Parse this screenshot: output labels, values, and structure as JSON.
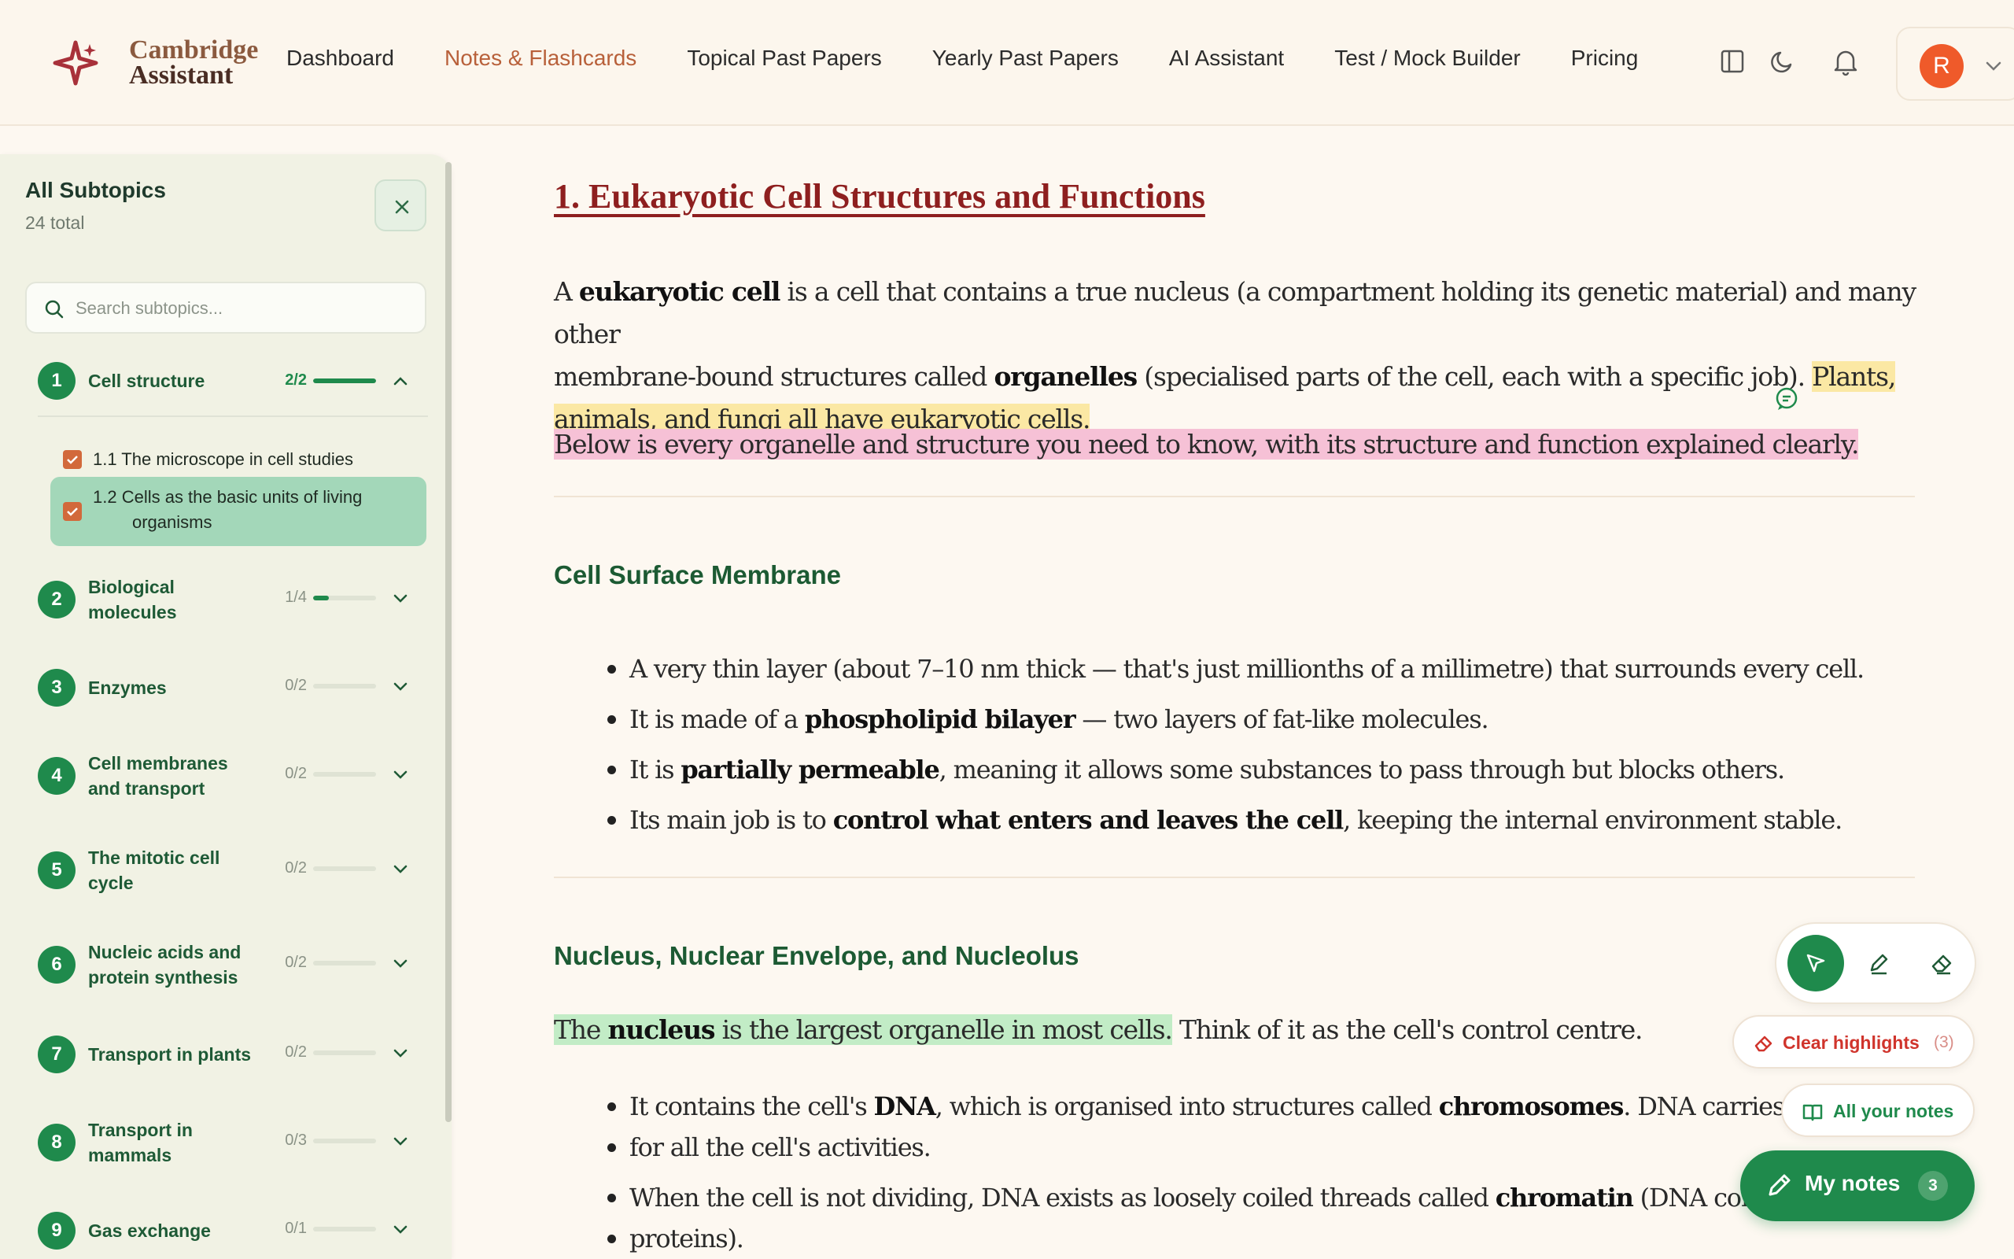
{
  "brand": {
    "line1": "Cambridge",
    "line2": "Assistant"
  },
  "nav": {
    "items": [
      {
        "label": "Dashboard",
        "active": false
      },
      {
        "label": "Notes & Flashcards",
        "active": true
      },
      {
        "label": "Topical Past Papers",
        "active": false
      },
      {
        "label": "Yearly Past Papers",
        "active": false
      },
      {
        "label": "AI Assistant",
        "active": false
      },
      {
        "label": "Test / Mock Builder",
        "active": false
      },
      {
        "label": "Pricing",
        "active": false
      }
    ]
  },
  "user": {
    "initial": "R"
  },
  "sidebar": {
    "title": "All Subtopics",
    "count": "24 total",
    "search_placeholder": "Search subtopics...",
    "topics": [
      {
        "num": "1",
        "name": "Cell structure",
        "progress": "2/2",
        "fraction": 1.0,
        "expanded": true
      },
      {
        "num": "2",
        "name": "Biological molecules",
        "progress": "1/4",
        "fraction": 0.25,
        "expanded": false
      },
      {
        "num": "3",
        "name": "Enzymes",
        "progress": "0/2",
        "fraction": 0,
        "expanded": false
      },
      {
        "num": "4",
        "name": "Cell membranes and transport",
        "progress": "0/2",
        "fraction": 0,
        "expanded": false
      },
      {
        "num": "5",
        "name": "The mitotic cell cycle",
        "progress": "0/2",
        "fraction": 0,
        "expanded": false
      },
      {
        "num": "6",
        "name": "Nucleic acids and protein synthesis",
        "progress": "0/2",
        "fraction": 0,
        "expanded": false
      },
      {
        "num": "7",
        "name": "Transport in plants",
        "progress": "0/2",
        "fraction": 0,
        "expanded": false
      },
      {
        "num": "8",
        "name": "Transport in mammals",
        "progress": "0/3",
        "fraction": 0,
        "expanded": false
      },
      {
        "num": "9",
        "name": "Gas exchange",
        "progress": "0/1",
        "fraction": 0,
        "expanded": false
      }
    ],
    "subtopics": [
      {
        "label": "1.1 The microscope in cell studies",
        "checked": true,
        "active": false
      },
      {
        "label_line1": "1.2 Cells as the basic units of living",
        "label_line2": "organisms",
        "checked": true,
        "active": true
      }
    ]
  },
  "content": {
    "title": "1. Eukaryotic Cell Structures and Functions",
    "intro": {
      "p1_a": "A ",
      "p1_b": "eukaryotic cell",
      "p1_c": " is a cell that contains a true nucleus (a compartment holding its genetic material) and many other",
      "p1_d": "membrane-bound structures called ",
      "p1_e": "organelles",
      "p1_f": " (specialised parts of the cell, each with a specific job). ",
      "p1_g": "Plants,",
      "p1_h": "animals, and fungi all have eukaryotic cells.",
      "p2": "Below is every organelle and structure you need to know, with its structure and function explained clearly."
    },
    "sections": [
      {
        "heading": "Cell Surface Membrane",
        "bullets": [
          {
            "a": "A very thin layer (about 7–10 nm thick — that's just millionths of a millimetre) that surrounds every cell.",
            "b": "",
            "c": ""
          },
          {
            "a": "It is made of a ",
            "b": "phospholipid bilayer",
            "c": " — two layers of fat-like molecules."
          },
          {
            "a": "It is ",
            "b": "partially permeable",
            "c": ", meaning it allows some substances to pass through but blocks others."
          },
          {
            "a": "Its main job is to ",
            "b": "control what enters and leaves the cell",
            "c": ", keeping the internal environment stable."
          }
        ]
      },
      {
        "heading": "Nucleus, Nuclear Envelope, and Nucleolus",
        "intro_a": "The ",
        "intro_b": "nucleus",
        "intro_c": " is the largest organelle in most cells.",
        "intro_d": " Think of it as the cell's control centre.",
        "bullets": [
          {
            "a": "It contains the cell's ",
            "b": "DNA",
            "c": ", which is organised into structures called ",
            "d": "chromosomes",
            "e": ". DNA carries inst",
            "line2": "for all the cell's activities."
          },
          {
            "a": "When the cell is not dividing, DNA exists as loosely coiled threads called ",
            "b": "chromatin",
            "c": " (DNA combi",
            "line2": "proteins)."
          }
        ]
      }
    ]
  },
  "tools": {
    "clear_label": "Clear highlights",
    "clear_count": "(3)",
    "all_notes_label": "All your notes",
    "my_notes_label": "My notes",
    "my_notes_count": "3"
  },
  "colors": {
    "accent_green": "#1f8a4c",
    "nav_active": "#b8603a",
    "title_red": "#8e1f1f",
    "highlight_yellow": "#fbe8a4",
    "highlight_pink": "#f6c1d6",
    "highlight_green": "#c2ecc6"
  }
}
